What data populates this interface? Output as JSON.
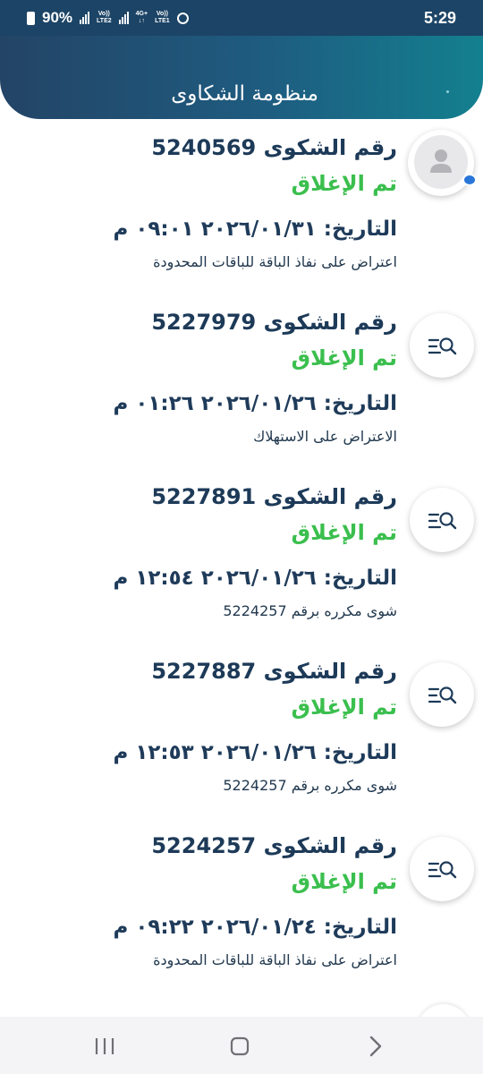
{
  "status_bar": {
    "battery": "90%",
    "sim2_label": [
      "Vo))",
      "LTE2"
    ],
    "sim1_net": [
      "4G+",
      "↓↑"
    ],
    "sim1_label": [
      "Vo))",
      "LTE1"
    ],
    "time": "5:29"
  },
  "header": {
    "title": "منظومة الشكاوى"
  },
  "complaints": [
    {
      "number": "رقم الشكوى 5240569",
      "status": "تم الإغلاق",
      "date": "التاريخ: ٢٠٢٦/٠١/٣١ ٠٩:٠١ م",
      "description": "اعتراض على نفاذ الباقة للباقات المحدودة"
    },
    {
      "number": "رقم الشكوى 5227979",
      "status": "تم الإغلاق",
      "date": "التاريخ: ٢٠٢٦/٠١/٢٦ ٠١:٢٦ م",
      "description": "الاعتراض على الاستهلاك"
    },
    {
      "number": "رقم الشكوى 5227891",
      "status": "تم الإغلاق",
      "date": "التاريخ: ٢٠٢٦/٠١/٢٦ ١٢:٥٤ م",
      "description": "شوى مكرره برقم 5224257"
    },
    {
      "number": "رقم الشكوى 5227887",
      "status": "تم الإغلاق",
      "date": "التاريخ: ٢٠٢٦/٠١/٢٦ ١٢:٥٣ م",
      "description": "شوى مكرره برقم 5224257"
    },
    {
      "number": "رقم الشكوى 5224257",
      "status": "تم الإغلاق",
      "date": "التاريخ: ٢٠٢٦/٠١/٢٤ ٠٩:٢٢ م",
      "description": "اعتراض على نفاذ الباقة للباقات المحدودة"
    }
  ],
  "icons": {
    "first_row": "avatar-icon",
    "other_rows": "search-list-icon",
    "nav_left": "recent-apps-icon",
    "nav_center": "home-icon",
    "nav_right": "back-icon"
  },
  "colors": {
    "status_bar": "#1c4466",
    "header_start": "#234466",
    "header_end": "#13808f",
    "status_closed": "#3bbf4e",
    "text_dark": "#1d3a58"
  }
}
